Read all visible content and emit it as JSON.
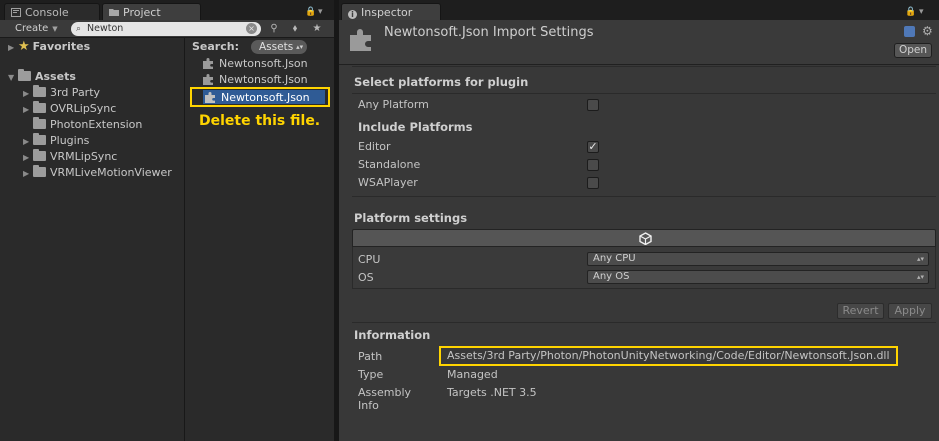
{
  "left_panel": {
    "tabs": [
      {
        "label": "Console",
        "icon": "console-icon"
      },
      {
        "label": "Project",
        "icon": "folder-icon"
      }
    ],
    "toolbar": {
      "create_label": "Create",
      "search_value": "Newton"
    },
    "tree": {
      "favorites": "Favorites",
      "assets": "Assets",
      "folders": [
        "3rd Party",
        "OVRLipSync",
        "PhotonExtension",
        "Plugins",
        "VRMLipSync",
        "VRMLiveMotionViewer"
      ]
    },
    "results": {
      "search_label": "Search:",
      "scope": "Assets",
      "items": [
        "Newtonsoft.Json",
        "Newtonsoft.Json",
        "Newtonsoft.Json"
      ]
    },
    "callout": "Delete this file."
  },
  "inspector": {
    "tab_label": "Inspector",
    "title": "Newtonsoft.Json Import Settings",
    "open_label": "Open",
    "select_platforms_title": "Select platforms for plugin",
    "any_platform_label": "Any Platform",
    "any_platform_checked": false,
    "include_platforms_title": "Include Platforms",
    "platforms": [
      {
        "label": "Editor",
        "checked": true
      },
      {
        "label": "Standalone",
        "checked": false
      },
      {
        "label": "WSAPlayer",
        "checked": false
      }
    ],
    "platform_settings_title": "Platform settings",
    "cpu_label": "CPU",
    "cpu_value": "Any CPU",
    "os_label": "OS",
    "os_value": "Any OS",
    "revert_label": "Revert",
    "apply_label": "Apply",
    "information_title": "Information",
    "path_label": "Path",
    "path_value": "Assets/3rd Party/Photon/PhotonUnityNetworking/Code/Editor/Newtonsoft.Json.dll",
    "type_label": "Type",
    "type_value": "Managed",
    "assembly_info_label_1": "Assembly",
    "assembly_info_label_2": "Info",
    "assembly_info_value": "Targets .NET 3.5"
  },
  "colors": {
    "highlight": "#ffd400",
    "selection": "#2f5b95"
  }
}
